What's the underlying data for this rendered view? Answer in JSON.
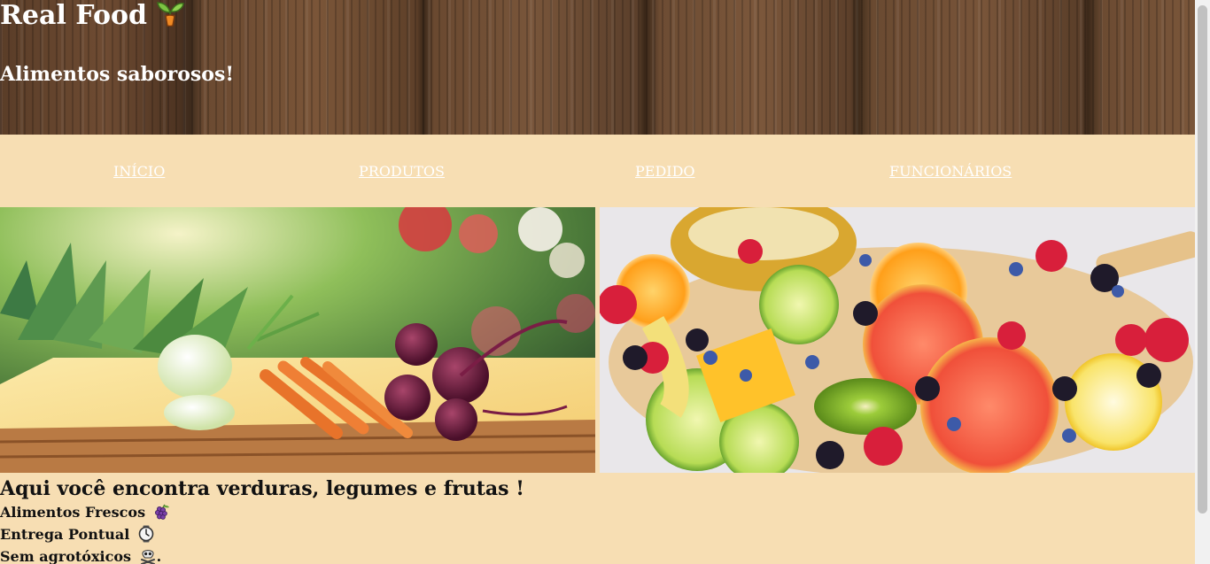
{
  "header": {
    "title": "Real Food",
    "title_icon": "sprout-icon",
    "subtitle": "Alimentos saborosos!"
  },
  "nav": {
    "items": [
      {
        "label": "INÍCIO"
      },
      {
        "label": "PRODUTOS"
      },
      {
        "label": "PEDIDO"
      },
      {
        "label": "FUNCIONÁRIOS"
      }
    ],
    "link_color": "#ffffff",
    "background": "#f7deb3"
  },
  "gallery": {
    "images": [
      {
        "name": "vegetable-basket-photo"
      },
      {
        "name": "fruit-platter-photo"
      }
    ]
  },
  "content": {
    "heading": "Aqui você encontra verduras, legumes e frutas !",
    "features": [
      {
        "label": "Alimentos Frescos",
        "icon": "grapes-icon"
      },
      {
        "label": "Entrega Pontual",
        "icon": "watch-icon"
      },
      {
        "label": "Sem agrotóxicos",
        "icon": "skull-crossbones-icon",
        "suffix": "."
      }
    ]
  },
  "colors": {
    "page_background": "#f7deb3",
    "header_wood": "#6b4a31",
    "text": "#111111"
  }
}
